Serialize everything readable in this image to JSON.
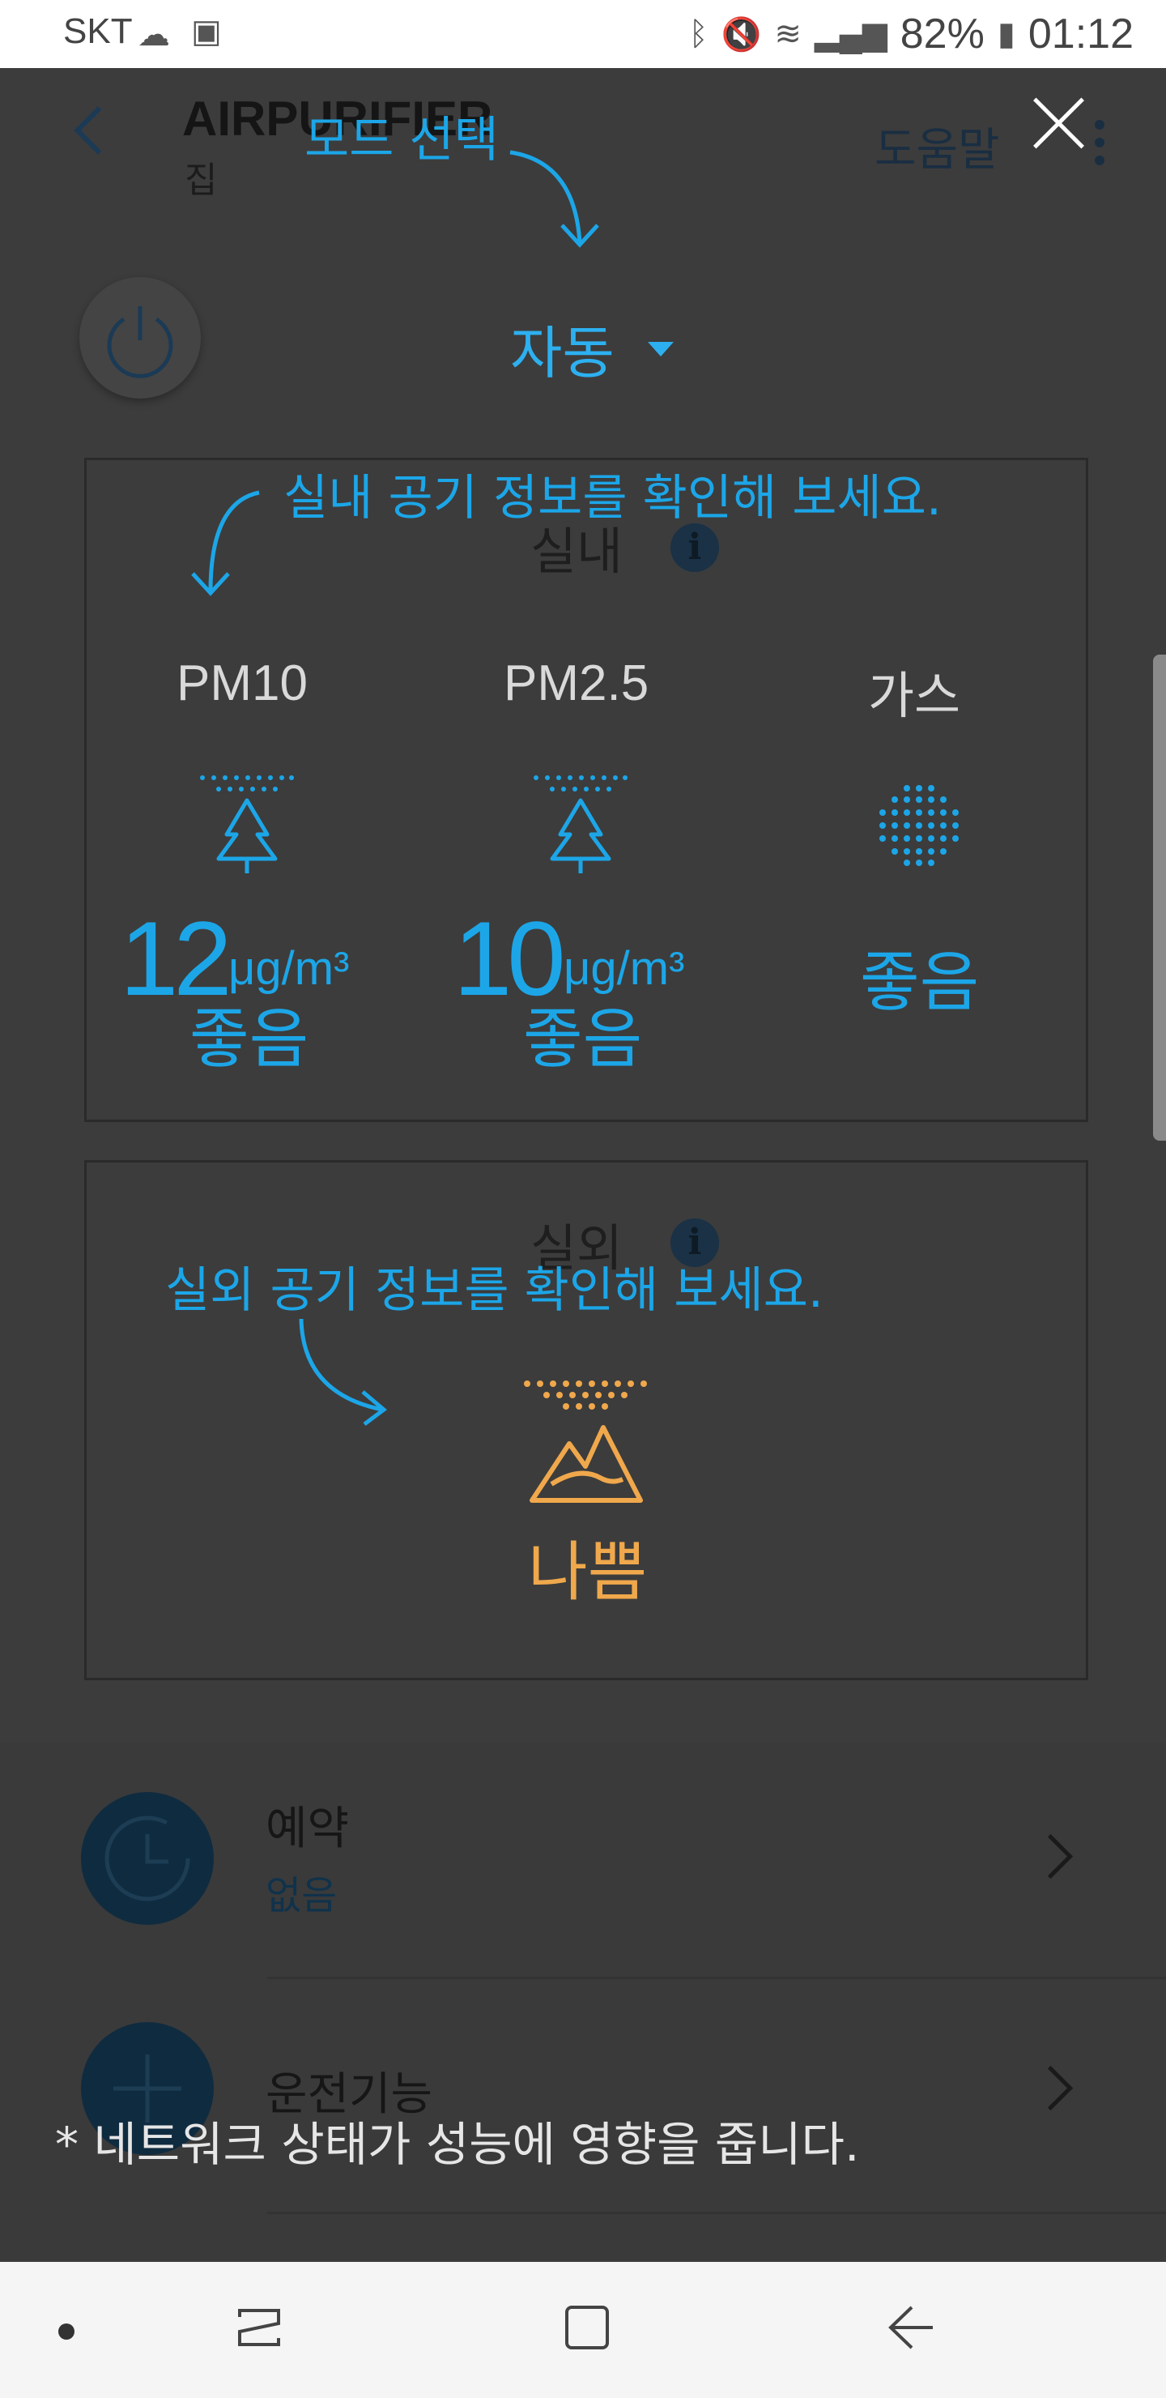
{
  "status_bar": {
    "carrier": "SKT",
    "battery": "82%",
    "time": "01:12"
  },
  "app": {
    "title": "AIRPURIFIER",
    "subtitle": "집",
    "help_label": "도움말"
  },
  "coach_marks": {
    "mode_select": "모드 선택",
    "mode_value": "자동",
    "indoor_tip": "실내 공기 정보를 확인해 보세요.",
    "outdoor_tip": "실외 공기 정보를 확인해 보세요.",
    "footnote": "* 네트워크 상태가 성능에 영향을 줍니다."
  },
  "indoor": {
    "title": "실내",
    "items": [
      {
        "label": "PM10",
        "value": "12",
        "unit": "μg/m³",
        "status": "좋음"
      },
      {
        "label": "PM2.5",
        "value": "10",
        "unit": "μg/m³",
        "status": "좋음"
      },
      {
        "label": "가스",
        "status": "좋음"
      }
    ]
  },
  "outdoor": {
    "title": "실외",
    "status": "나쁨"
  },
  "list": [
    {
      "title": "예약",
      "subtitle": "없음"
    },
    {
      "title": "운전기능"
    }
  ],
  "colors": {
    "accent_blue": "#1ca6e8",
    "warning_orange": "#f0a84c"
  }
}
